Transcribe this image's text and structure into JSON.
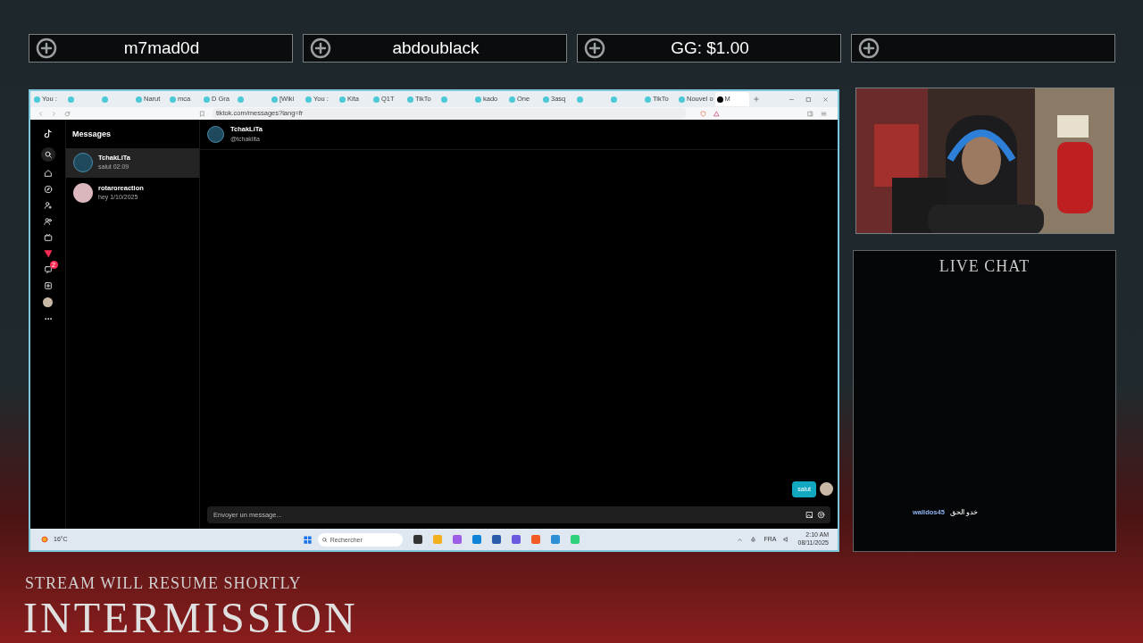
{
  "top_bars": [
    {
      "kind": "text",
      "label": "m7mad0d"
    },
    {
      "kind": "text",
      "label": "abdoublack"
    },
    {
      "kind": "text",
      "label": "GG: $1.00"
    },
    {
      "kind": "blank"
    }
  ],
  "browser": {
    "tabs": [
      {
        "label": "You :",
        "selected": false
      },
      {
        "selected": false
      },
      {
        "selected": false
      },
      {
        "label": "Narut",
        "selected": false
      },
      {
        "label": "mca",
        "selected": false
      },
      {
        "label": "D Gra",
        "selected": false
      },
      {
        "selected": false
      },
      {
        "label": "[Wiki",
        "selected": false
      },
      {
        "label": "You :",
        "selected": false
      },
      {
        "label": "Kita",
        "selected": false
      },
      {
        "label": "Q1T",
        "selected": false
      },
      {
        "label": "TikTo",
        "selected": false
      },
      {
        "selected": false
      },
      {
        "label": "kado",
        "selected": false
      },
      {
        "label": "One",
        "selected": false
      },
      {
        "label": "3asq",
        "selected": false
      },
      {
        "selected": false
      },
      {
        "selected": false
      },
      {
        "label": "TikTo",
        "selected": false
      },
      {
        "label": "Nouvel o",
        "selected": false
      },
      {
        "label": "M",
        "selected": true
      }
    ],
    "url": "tiktok.com/messages?lang=fr"
  },
  "tiktok": {
    "title": "Messages",
    "notification_count": "2",
    "conversations": [
      {
        "name": "TchakLiTa",
        "preview": "salut 02:09",
        "selected": true
      },
      {
        "name": "rotaroreaction",
        "preview": "hey 1/10/2025",
        "selected": false
      }
    ],
    "chat_header": {
      "name": "TchakLiTa",
      "handle": "@tchaklita"
    },
    "messages": [
      {
        "text": "salut"
      }
    ],
    "composer": {
      "placeholder": "Envoyer un message..."
    }
  },
  "taskbar": {
    "weather": "16°C",
    "search_placeholder": "Rechercher",
    "language": "FRA",
    "time": "2:10 AM",
    "date": "08/11/2025"
  },
  "live_chat": {
    "title": "LIVE CHAT",
    "messages": [
      {
        "user": "walidos45",
        "text": "خدو الحق"
      }
    ]
  },
  "overlay": {
    "subtitle": "STREAM WILL RESUME SHORTLY",
    "title": "INTERMISSION"
  }
}
